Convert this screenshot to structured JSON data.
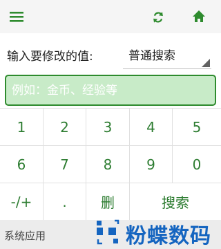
{
  "header": {
    "menu_icon": "menu-icon",
    "refresh_icon": "refresh-icon",
    "home_icon": "home-icon",
    "accent": "#2e8b2e"
  },
  "form": {
    "modify_label": "输入要修改的值:",
    "mode_selected": "普通搜索",
    "input_placeholder": "例如：金币、经验等",
    "input_value": ""
  },
  "keypad": {
    "row1": [
      "1",
      "2",
      "3",
      "4",
      "5"
    ],
    "row2": [
      "6",
      "7",
      "8",
      "9",
      "0"
    ],
    "row3": [
      "-/+",
      ".",
      "删",
      "搜索"
    ]
  },
  "footer": {
    "system_apps_label": "系统应用",
    "watermark_text": "粉蝶数码"
  }
}
